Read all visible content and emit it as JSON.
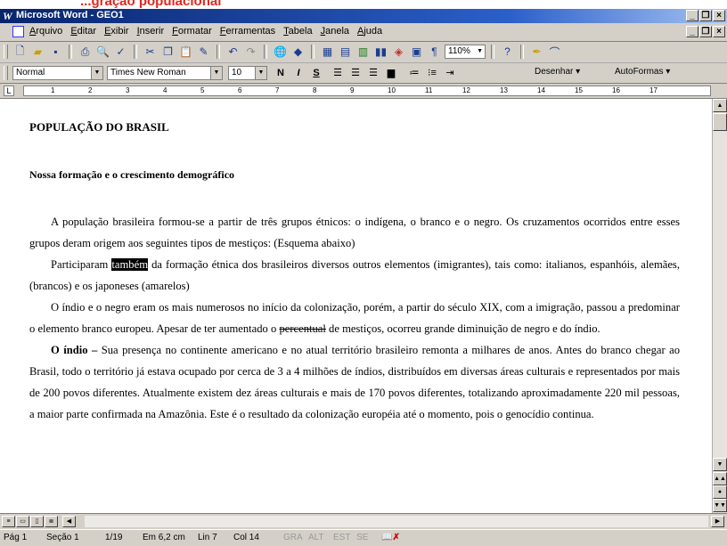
{
  "caption": "...gração populacional",
  "window": {
    "title": "Microsoft Word - GEO1",
    "app_icon": "W"
  },
  "menu": [
    "Arquivo",
    "Editar",
    "Exibir",
    "Inserir",
    "Formatar",
    "Ferramentas",
    "Tabela",
    "Janela",
    "Ajuda"
  ],
  "toolbar": {
    "icons": [
      "new-icon",
      "open-icon",
      "save-icon",
      "print-icon",
      "print-preview-icon",
      "spelling-icon",
      "cut-icon",
      "copy-icon",
      "paste-icon",
      "format-painter-icon",
      "undo-icon",
      "redo-icon",
      "hyperlink-icon",
      "web-toolbar-icon",
      "tables-icon",
      "insert-table-icon",
      "excel-icon",
      "columns-icon",
      "drawing-icon",
      "document-map-icon",
      "show-hide-icon"
    ],
    "zoom": "110%"
  },
  "format": {
    "style": "Normal",
    "font": "Times New Roman",
    "size": "10",
    "bold": "N",
    "italic": "I",
    "underline": "S",
    "draw": "Desenhar",
    "autoshapes": "AutoFormas"
  },
  "ruler": {
    "numbers": [
      "1",
      "2",
      "3",
      "4",
      "5",
      "6",
      "7",
      "8",
      "9",
      "10",
      "11",
      "12",
      "13",
      "14",
      "15",
      "16",
      "17"
    ]
  },
  "document": {
    "title": "POPULAÇÃO DO BRASIL",
    "subtitle": "Nossa formação e o crescimento demográfico",
    "p1": "A população brasileira formou-se a partir de três grupos étnicos: o indígena, o branco e o negro. Os cruzamentos ocorridos entre esses grupos deram origem aos seguintes tipos de mestiços: (Esquema abaixo)",
    "p2_before": "Participaram ",
    "p2_selected": "também",
    "p2_after": " da formação étnica dos brasileiros diversos outros elementos (imigrantes), tais como: italianos, espanhóis, alemães, (brancos) e os japoneses (amarelos)",
    "p3_before": "O índio e o negro eram os mais numerosos no início da colonização, porém, a partir do século XIX, com a imigração, passou a predominar o elemento branco europeu. Apesar de ter aumentado o ",
    "p3_strike": "percentual",
    "p3_after": " de mestiços, ocorreu grande diminuição de negro e do índio.",
    "p4_bold": "O índio –",
    "p4_rest": " Sua presença no continente americano e no atual território brasileiro remonta a milhares de anos. Antes do branco chegar ao Brasil, todo o território já estava ocupado por cerca de 3 a 4 milhões de índios, distribuídos em diversas áreas culturais e representados por mais de 200 povos diferentes. Atualmente existem dez áreas culturais e mais de 170 povos diferentes, totalizando aproximadamente 220 mil pessoas, a maior parte confirmada na Amazônia. Este é o resultado da colonização européia até o momento, pois o genocídio continua."
  },
  "status": {
    "page": "Pág 1",
    "section": "Seção 1",
    "pages": "1/19",
    "at": "Em 6,2 cm",
    "line": "Lin 7",
    "col": "Col 14",
    "gra": "GRA",
    "alt": "ALT",
    "est": "EST",
    "se": "SE"
  }
}
